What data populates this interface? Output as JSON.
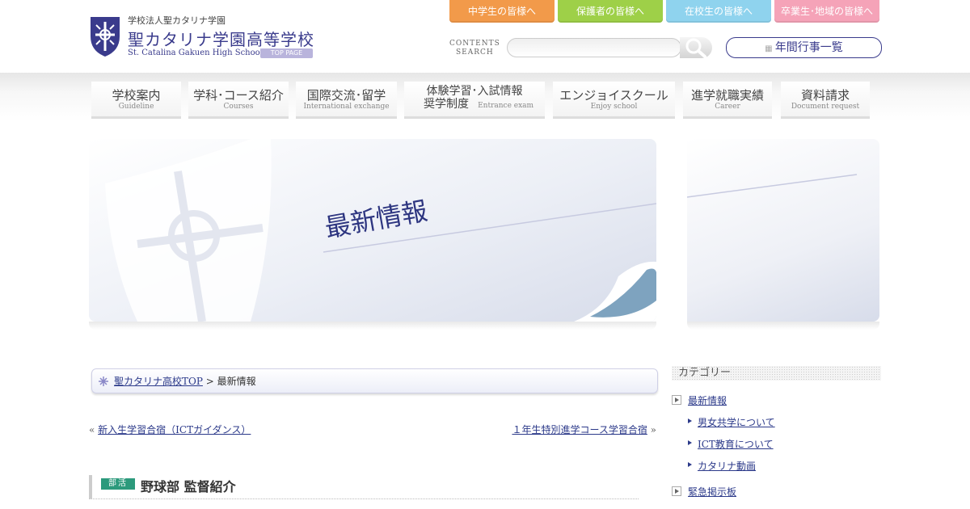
{
  "header": {
    "school_sub": "学校法人聖カタリナ学園",
    "school_name": "聖カタリナ学園高等学校",
    "school_en": "St. Catalina Gakuen High School",
    "top_page_badge": "TOP PAGE",
    "audience_tabs": [
      {
        "label": "中学生の皆様へ",
        "color": "#f29a4a"
      },
      {
        "label": "保護者の皆様へ",
        "color": "#9ed048"
      },
      {
        "label": "在校生の皆様へ",
        "color": "#8fd3ee"
      },
      {
        "label": "卒業生･地域の皆様へ",
        "color": "#f5a3b8"
      }
    ],
    "contents_search": "CONTENTS\nSEARCH",
    "search_placeholder": "",
    "annual_events": "年間行事一覧"
  },
  "nav": [
    {
      "jp": "学校案内",
      "en": "Guideline"
    },
    {
      "jp": "学科･コース紹介",
      "en": "Courses"
    },
    {
      "jp": "国際交流･留学",
      "en": "International exchange"
    },
    {
      "jp": "体験学習･入試情報",
      "jp2": "奨学制度",
      "en": "Entrance exam"
    },
    {
      "jp": "エンジョイスクール",
      "en": "Enjoy school"
    },
    {
      "jp": "進学就職実績",
      "en": "Career"
    },
    {
      "jp": "資料請求",
      "en": "Document request"
    }
  ],
  "banner": {
    "title": "最新情報"
  },
  "breadcrumb": {
    "home": "聖カタリナ高校TOP",
    "separator": " > ",
    "current": "最新情報"
  },
  "post_nav": {
    "prev_mark": "« ",
    "prev": "新入生学習合宿（ICTガイダンス）",
    "next": "１年生特別進学コース学習合宿",
    "next_mark": " »"
  },
  "post": {
    "category": "部活",
    "title": "野球部 監督紹介"
  },
  "sidebar": {
    "heading": "カテゴリー",
    "items": [
      {
        "label": "最新情報"
      },
      {
        "label": "男女共学について"
      },
      {
        "label": "ICT教育について"
      },
      {
        "label": "カタリナ動画"
      },
      {
        "label": "緊急掲示板"
      }
    ]
  }
}
